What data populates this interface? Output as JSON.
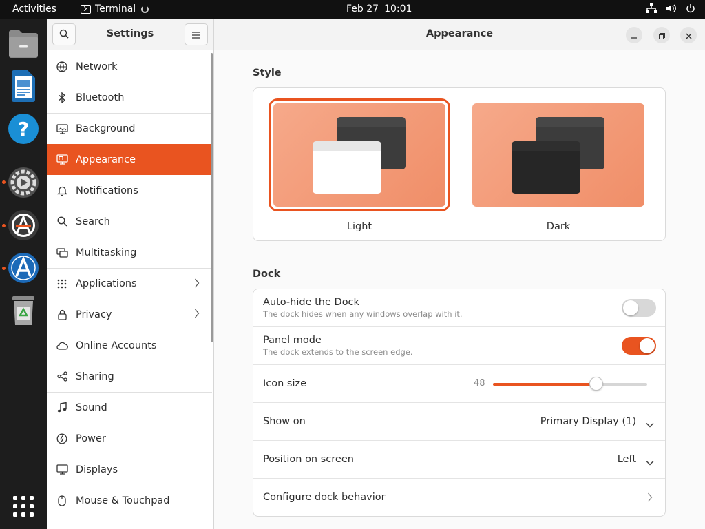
{
  "topbar": {
    "activities": "Activities",
    "app_name": "Terminal",
    "date": "Feb 27",
    "time": "10:01",
    "tray_icons": [
      "network-icon",
      "volume-icon",
      "power-icon"
    ]
  },
  "dock": {
    "items": [
      {
        "name": "files-icon",
        "running": false
      },
      {
        "name": "writer-icon",
        "running": false
      },
      {
        "name": "help-icon",
        "running": false
      },
      {
        "name": "settings-icon",
        "running": true
      },
      {
        "name": "software-updater-icon",
        "running": true
      },
      {
        "name": "app-center-icon",
        "running": true
      },
      {
        "name": "trash-icon",
        "running": false
      }
    ],
    "show_apps_icon": "grid-icon"
  },
  "sidebar": {
    "title": "Settings",
    "items": [
      {
        "label": "Network",
        "icon": "network-globe-icon",
        "chevron": false
      },
      {
        "label": "Bluetooth",
        "icon": "bluetooth-icon",
        "chevron": false
      },
      {
        "label": "Background",
        "icon": "background-icon",
        "chevron": false
      },
      {
        "label": "Appearance",
        "icon": "appearance-icon",
        "chevron": false,
        "active": true
      },
      {
        "label": "Notifications",
        "icon": "bell-icon",
        "chevron": false
      },
      {
        "label": "Search",
        "icon": "search-icon",
        "chevron": false
      },
      {
        "label": "Multitasking",
        "icon": "multitasking-icon",
        "chevron": false
      },
      {
        "label": "Applications",
        "icon": "apps-grid-icon",
        "chevron": true
      },
      {
        "label": "Privacy",
        "icon": "lock-icon",
        "chevron": true
      },
      {
        "label": "Online Accounts",
        "icon": "cloud-icon",
        "chevron": false
      },
      {
        "label": "Sharing",
        "icon": "share-icon",
        "chevron": false
      },
      {
        "label": "Sound",
        "icon": "music-note-icon",
        "chevron": false
      },
      {
        "label": "Power",
        "icon": "power-icon",
        "chevron": false
      },
      {
        "label": "Displays",
        "icon": "display-icon",
        "chevron": false
      },
      {
        "label": "Mouse & Touchpad",
        "icon": "mouse-icon",
        "chevron": false
      }
    ]
  },
  "main": {
    "title": "Appearance",
    "style_section": "Style",
    "styles": [
      {
        "label": "Light",
        "selected": true
      },
      {
        "label": "Dark",
        "selected": false
      }
    ],
    "dock_section": "Dock",
    "dock_rows": {
      "autohide": {
        "label": "Auto-hide the Dock",
        "sub": "The dock hides when any windows overlap with it.",
        "on": false
      },
      "panel": {
        "label": "Panel mode",
        "sub": "The dock extends to the screen edge.",
        "on": true
      },
      "icon_size": {
        "label": "Icon size",
        "value": "48",
        "fraction": 0.67
      },
      "show_on": {
        "label": "Show on",
        "value": "Primary Display (1)"
      },
      "position": {
        "label": "Position on screen",
        "value": "Left"
      },
      "configure": {
        "label": "Configure dock behavior"
      }
    }
  },
  "colors": {
    "accent": "#e95420",
    "toggle_off": "#d8d8d8"
  }
}
